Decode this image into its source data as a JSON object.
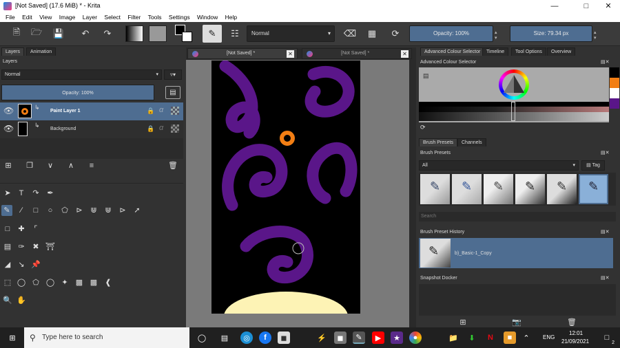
{
  "window": {
    "title": "[Not Saved]  (17.6 MiB)  * - Krita"
  },
  "menu": [
    "File",
    "Edit",
    "View",
    "Image",
    "Layer",
    "Select",
    "Filter",
    "Tools",
    "Settings",
    "Window",
    "Help"
  ],
  "toolbar": {
    "blend_mode": "Normal",
    "opacity": "Opacity: 100%",
    "size": "Size: 79.34 px"
  },
  "layers_docker": {
    "tabs": [
      "Layers",
      "Animation"
    ],
    "title": "Layers",
    "blend_mode": "Normal",
    "opacity": "Opacity:  100%",
    "layers": [
      {
        "name": "Paint Layer 1",
        "selected": true
      },
      {
        "name": "Background",
        "selected": false
      }
    ]
  },
  "document_tabs": [
    "[Not Saved]  *",
    "[Not Saved]  *"
  ],
  "right_tabs": [
    "Advanced Colour Selector",
    "Timeline",
    "Tool Options",
    "Overview"
  ],
  "colour_selector": {
    "title": "Advanced Colour Selector",
    "swatches": [
      "#000000",
      "#f27e14",
      "#ffffff",
      "#5a1689"
    ]
  },
  "brush_presets": {
    "tabs": [
      "Brush Presets",
      "Channels"
    ],
    "title": "Brush Presets",
    "filter": "All",
    "tag_label": "Tag",
    "search_placeholder": "Search"
  },
  "preset_history": {
    "title": "Brush Preset History",
    "item": "b)_Basic-1_Copy"
  },
  "snapshot": {
    "title": "Snapshot Docker"
  },
  "taskbar": {
    "search_placeholder": "Type here to search",
    "lang": "ENG",
    "time": "12:01",
    "date": "21/09/2021",
    "notifications": "2"
  },
  "colors": {
    "accent": "#4e6d91",
    "stroke": "#5a1689",
    "dot": "#f27e14",
    "cream": "#fdf3b5"
  }
}
